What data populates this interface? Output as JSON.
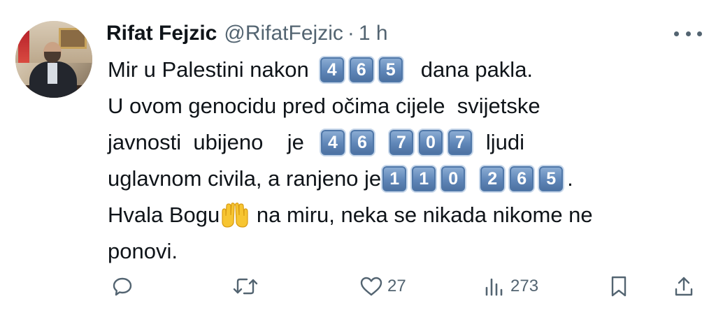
{
  "author": {
    "name": "Rifat Fejzic",
    "handle": "@RifatFejzic",
    "separator": "·",
    "time": "1 h"
  },
  "tweet": {
    "l1_pre": "Mir u Palestini nakon",
    "l1_keys": [
      "4",
      "6",
      "5"
    ],
    "l1_post": "dana pakla.",
    "l2": "U ovom genocidu pred očima cijele  svijetske",
    "l3_pre": "javnosti  ubijeno    je",
    "l3_keys": [
      "4",
      "6",
      "7",
      "0",
      "7"
    ],
    "l3_post": "ljudi",
    "l4_pre": "uglavnom civila, a ranjeno je",
    "l4_keys": [
      "1",
      "1",
      "0",
      "2",
      "6",
      "5"
    ],
    "l4_post": ".",
    "l5_pre": "Hvala Bogu",
    "l5_emoji": "raised-hands-emoji",
    "l5_post": " na miru, neka se nikada nikome ne",
    "l6": "ponovi."
  },
  "actions": {
    "reply_icon": "reply-icon",
    "retweet_icon": "retweet-icon",
    "like_icon": "heart-icon",
    "like_count": "27",
    "views_icon": "views-icon",
    "views_count": "273",
    "bookmark_icon": "bookmark-icon",
    "share_icon": "share-icon"
  },
  "colors": {
    "text": "#0f1419",
    "secondary": "#536471",
    "keycap": "#5f86b8"
  }
}
